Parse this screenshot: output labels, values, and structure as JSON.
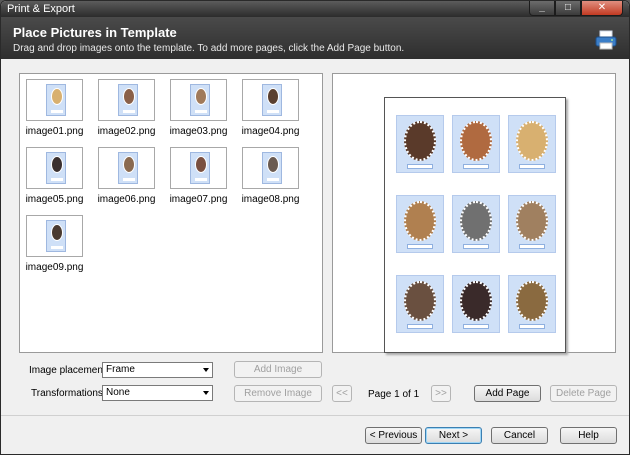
{
  "window": {
    "title": "Print & Export"
  },
  "header": {
    "title": "Place Pictures in Template",
    "subtitle": "Drag and drop images onto the template. To add more pages, click the Add Page button."
  },
  "thumbnails": [
    {
      "name": "image01.png",
      "color": "#d8b070"
    },
    {
      "name": "image02.png",
      "color": "#8a6048"
    },
    {
      "name": "image03.png",
      "color": "#a07a5a"
    },
    {
      "name": "image04.png",
      "color": "#5a4030"
    },
    {
      "name": "image05.png",
      "color": "#3a3030"
    },
    {
      "name": "image06.png",
      "color": "#8a6a50"
    },
    {
      "name": "image07.png",
      "color": "#7a5040"
    },
    {
      "name": "image08.png",
      "color": "#6a5a50"
    },
    {
      "name": "image09.png",
      "color": "#4a3a30"
    }
  ],
  "template_faces": [
    "#5a3a2a",
    "#b06a40",
    "#d8b070",
    "#b08050",
    "#707070",
    "#a08060",
    "#6a5040",
    "#3a2a2a",
    "#8a6a40"
  ],
  "controls": {
    "image_placement_label": "Image placement:",
    "image_placement_value": "Frame",
    "transformations_label": "Transformations:",
    "transformations_value": "None",
    "add_image": "Add Image",
    "remove_image": "Remove Image",
    "prev_page": "<<",
    "page_indicator": "Page 1 of 1",
    "next_page": ">>",
    "add_page": "Add Page",
    "delete_page": "Delete Page"
  },
  "footer": {
    "previous": "< Previous",
    "next": "Next >",
    "cancel": "Cancel",
    "help": "Help"
  },
  "window_buttons": {
    "minimize": "_",
    "maximize": "□",
    "close": "✕"
  }
}
